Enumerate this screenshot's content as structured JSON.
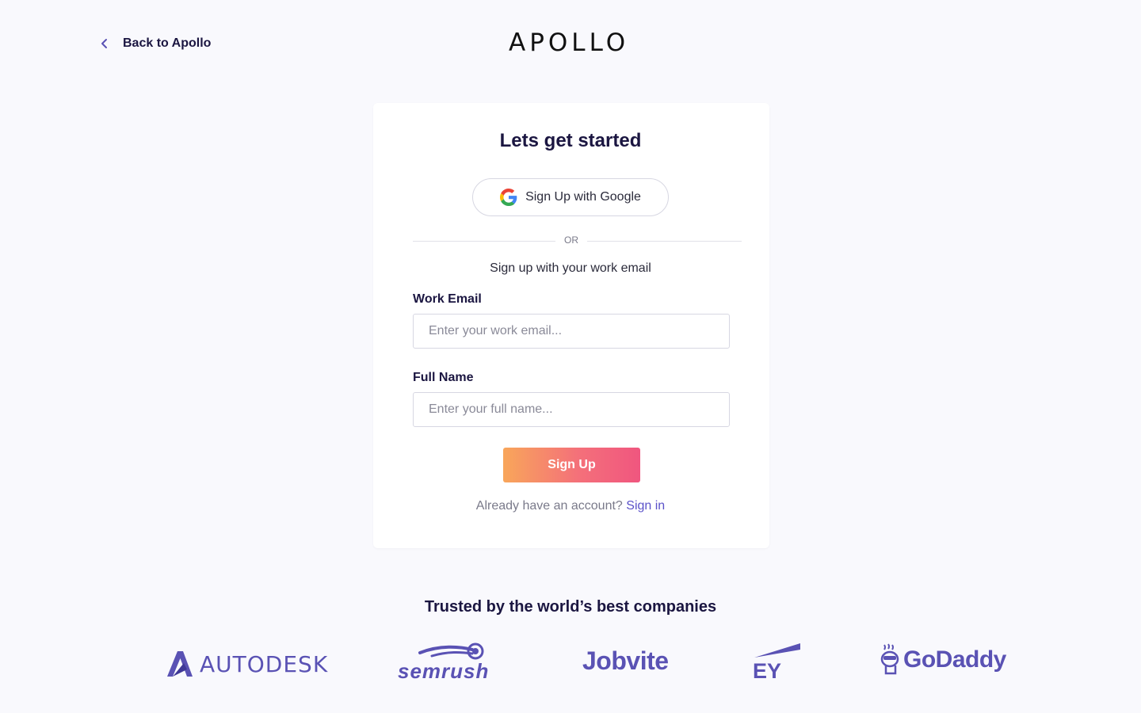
{
  "header": {
    "back_label": "Back to Apollo",
    "logo_text": "APOLLO"
  },
  "card": {
    "title": "Lets get started",
    "google_button_label": "Sign Up with Google",
    "divider_text": "OR",
    "subtitle": "Sign up with your work email",
    "email_label": "Work Email",
    "email_placeholder": "Enter your work email...",
    "email_value": "",
    "name_label": "Full Name",
    "name_placeholder": "Enter your full name...",
    "name_value": "",
    "submit_label": "Sign Up",
    "signin_prompt": "Already have an account?",
    "signin_link": "Sign in"
  },
  "trusted": {
    "heading": "Trusted by the world’s best companies",
    "logos": [
      {
        "name": "AUTODESK",
        "icon": "autodesk-logo"
      },
      {
        "name": "semrush",
        "icon": "semrush-logo"
      },
      {
        "name": "Jobvite",
        "icon": "jobvite-logo"
      },
      {
        "name": "EY",
        "icon": "ey-logo"
      },
      {
        "name": "GoDaddy",
        "icon": "godaddy-logo"
      }
    ]
  },
  "colors": {
    "background": "#f9f9fd",
    "text_primary": "#1b1641",
    "link": "#5b52c9",
    "logo_color": "#5a52b4",
    "button_gradient_start": "#f8a65a",
    "button_gradient_end": "#f0567f"
  }
}
